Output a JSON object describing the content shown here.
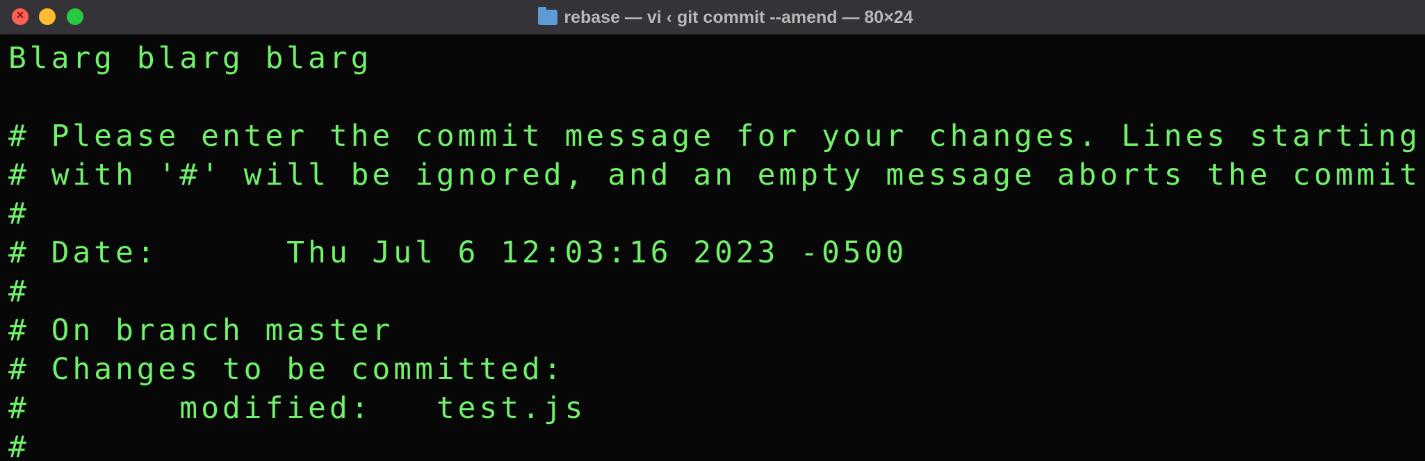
{
  "window": {
    "title": "rebase — vi ‹ git commit --amend — 80×24"
  },
  "colors": {
    "text": "#71f06a",
    "background": "#070707",
    "titlebar": "#343438"
  },
  "terminal": {
    "lines": [
      "Blarg blarg blarg",
      "",
      "# Please enter the commit message for your changes. Lines starting",
      "# with '#' will be ignored, and an empty message aborts the commit.",
      "#",
      "# Date:      Thu Jul 6 12:03:16 2023 -0500",
      "#",
      "# On branch master",
      "# Changes to be committed:",
      "#       modified:   test.js",
      "#"
    ]
  }
}
